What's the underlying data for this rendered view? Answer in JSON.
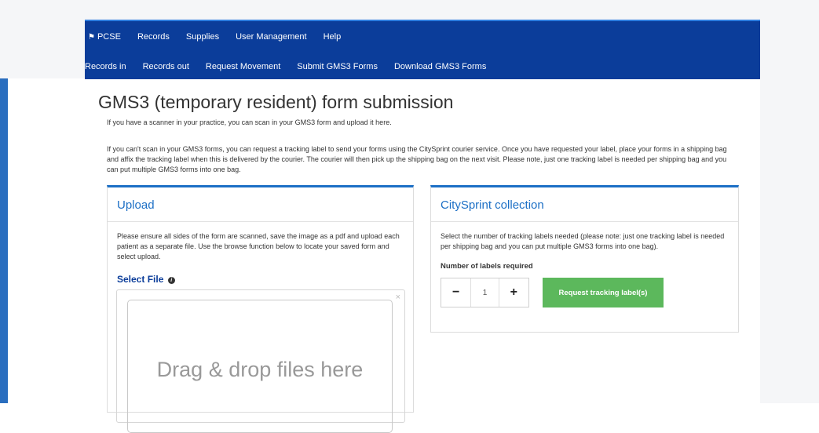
{
  "nav": {
    "primary": [
      {
        "label": "PCSE",
        "icon": "home-icon"
      },
      {
        "label": "Records"
      },
      {
        "label": "Supplies"
      },
      {
        "label": "User Management"
      },
      {
        "label": "Help"
      }
    ],
    "secondary": [
      {
        "label": "Records in"
      },
      {
        "label": "Records out"
      },
      {
        "label": "Request Movement"
      },
      {
        "label": "Submit GMS3 Forms"
      },
      {
        "label": "Download GMS3 Forms"
      }
    ]
  },
  "page": {
    "title": "GMS3 (temporary resident) form submission",
    "intro_scan": "If you have a scanner in your practice, you can scan in your GMS3 form and upload it here.",
    "intro_courier": "If you can't scan in your GMS3 forms, you can request a tracking label to send your forms using the CitySprint courier service. Once you have requested your label, place your forms in a shipping bag and affix the tracking label when this is delivered by the courier. The courier will then pick up the shipping bag on the next visit. Please note, just one tracking label is needed per shipping bag and you can put multiple GMS3 forms into one bag."
  },
  "upload": {
    "title": "Upload",
    "instructions": "Please ensure all sides of the form are scanned, save the image as a pdf and upload each patient as a separate file. Use the browse function below to locate your saved form and select upload.",
    "select_file_label": "Select File",
    "info_icon": "i",
    "dropzone_close": "×",
    "dropzone_text": "Drag & drop files here"
  },
  "citysprint": {
    "title": "CitySprint collection",
    "instructions": "Select the number of tracking labels needed (please note: just one tracking label is needed per shipping bag and you can put multiple GMS3 forms into one bag).",
    "labels_caption": "Number of labels required",
    "decrement": "−",
    "quantity": "1",
    "increment": "+",
    "request_button": "Request tracking label(s)"
  },
  "colors": {
    "navbar": "#0b3d9a",
    "accent": "#1c6fc5",
    "success": "#5cb85c"
  }
}
